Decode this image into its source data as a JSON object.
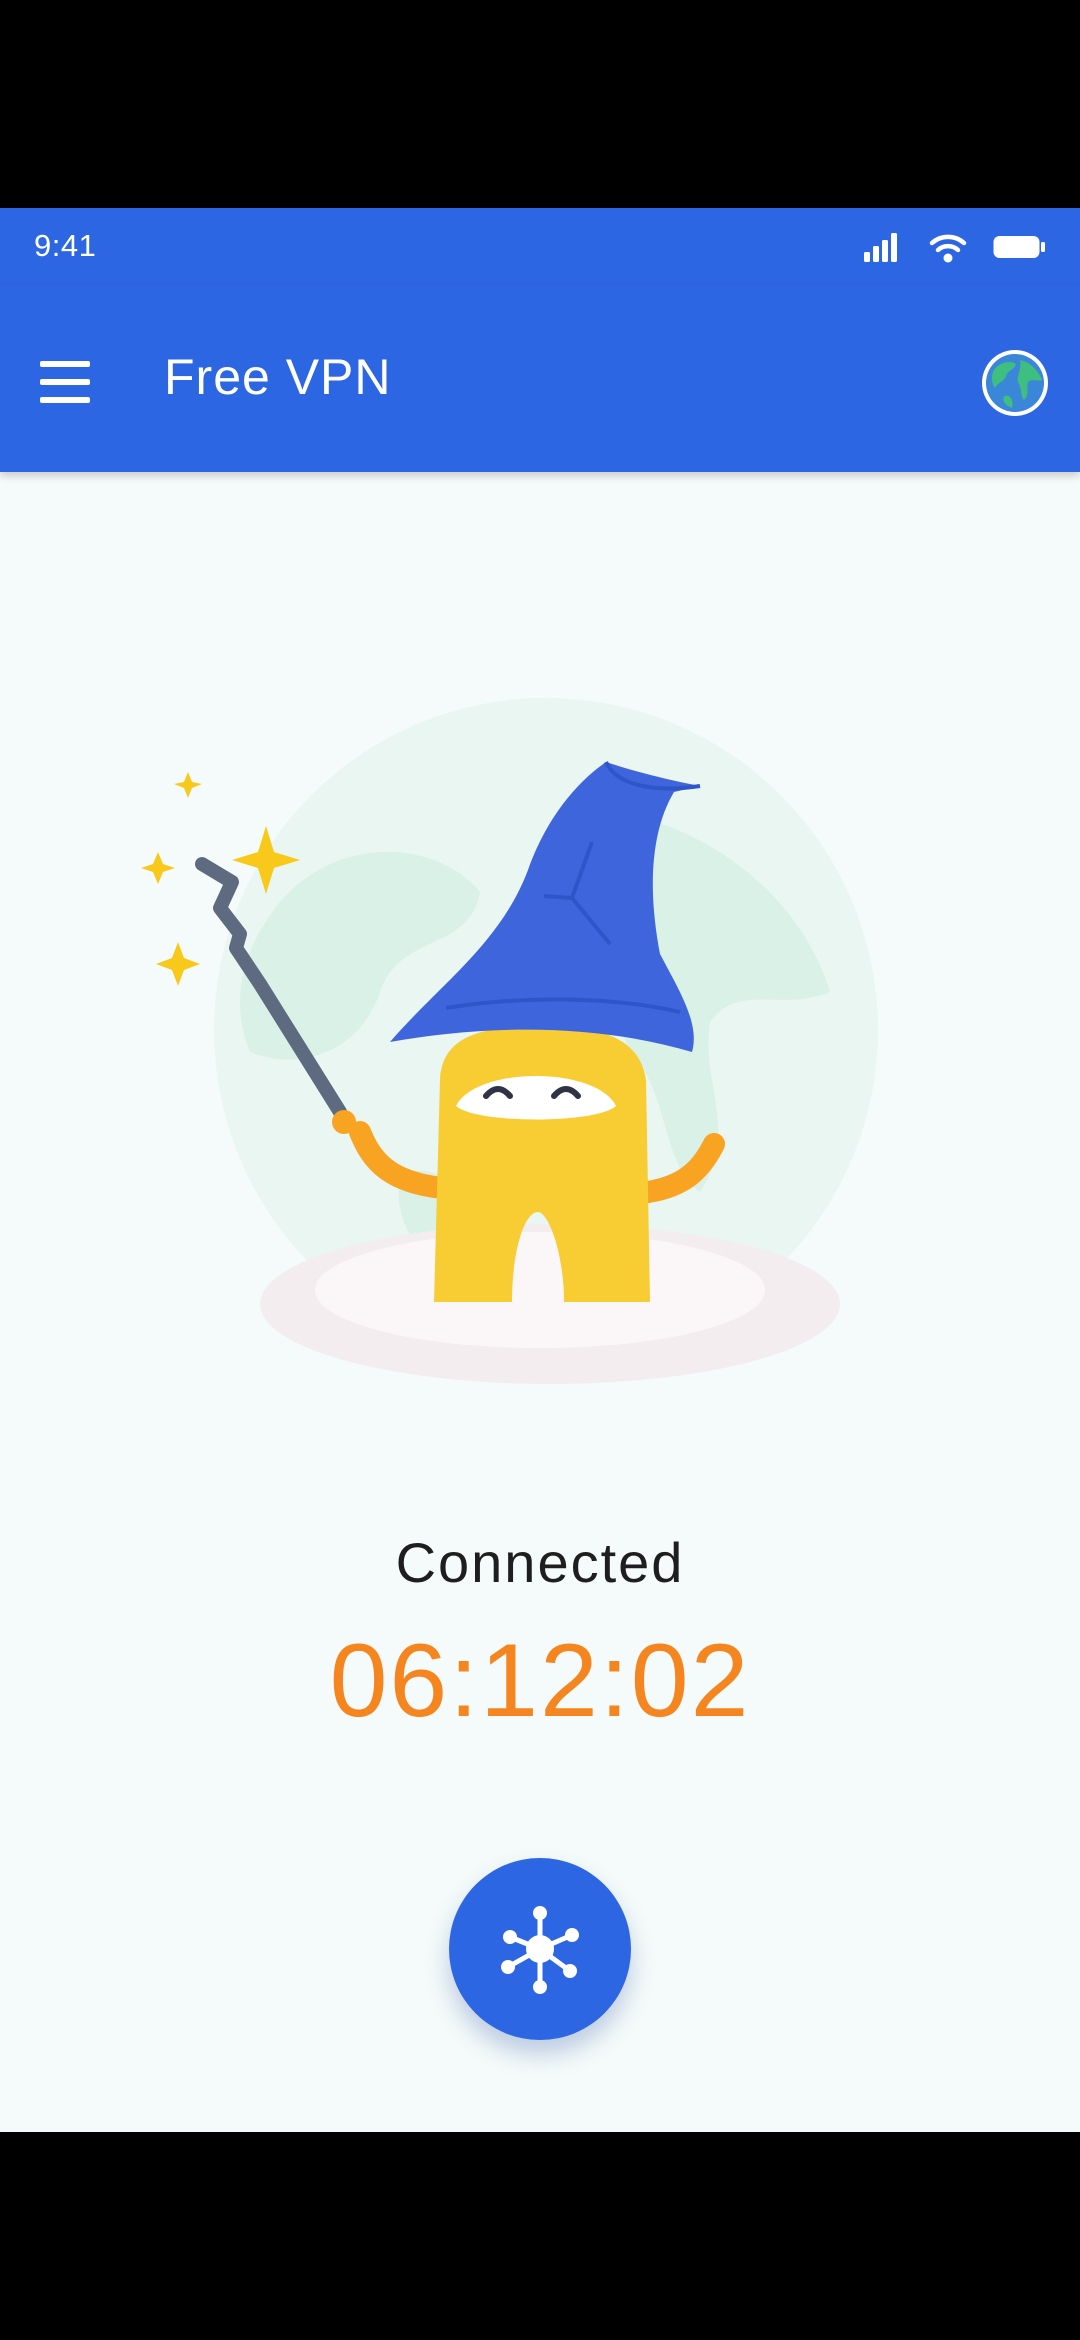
{
  "status_bar": {
    "time": "9:41",
    "icons": [
      "signal-icon",
      "wifi-icon",
      "battery-icon"
    ]
  },
  "app_bar": {
    "menu_icon": "hamburger-menu-icon",
    "title": "Free VPN",
    "action_icon": "globe-icon"
  },
  "illustration": {
    "name": "wizard-mascot-illustration"
  },
  "connection": {
    "status": "Connected",
    "timer": "06:12:02"
  },
  "connect_button": {
    "icon": "network-hub-icon"
  },
  "colors": {
    "primary": "#2d66e3",
    "accent": "#f5851f",
    "background": "#f5fbfa",
    "text": "#1e1e1e"
  }
}
